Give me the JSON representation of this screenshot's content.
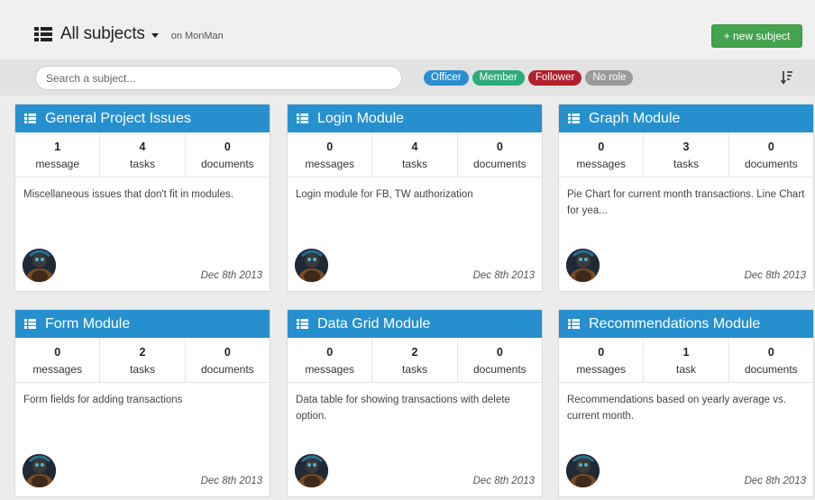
{
  "header": {
    "title": "All subjects",
    "context": "on MonMan",
    "new_button": "+ new subject"
  },
  "filter": {
    "search_placeholder": "Search a subject...",
    "roles": [
      {
        "label": "Officer",
        "color": "#2a8fd0"
      },
      {
        "label": "Member",
        "color": "#2dab7b"
      },
      {
        "label": "Follower",
        "color": "#b3202a"
      },
      {
        "label": "No role",
        "color": "#9a9a9a"
      }
    ]
  },
  "colors": {
    "accent": "#2690cf",
    "new_button": "#43a34e"
  },
  "icons": [
    "list-icon",
    "caret-down-icon",
    "sort-icon",
    "avatar"
  ],
  "subjects": [
    {
      "title": "General Project Issues",
      "stats": [
        {
          "num": "1",
          "label": "message"
        },
        {
          "num": "4",
          "label": "tasks"
        },
        {
          "num": "0",
          "label": "documents"
        }
      ],
      "description": "Miscellaneous issues that don't fit in modules.",
      "date": "Dec 8th 2013"
    },
    {
      "title": "Login Module",
      "stats": [
        {
          "num": "0",
          "label": "messages"
        },
        {
          "num": "4",
          "label": "tasks"
        },
        {
          "num": "0",
          "label": "documents"
        }
      ],
      "description": "Login module for FB, TW authorization",
      "date": "Dec 8th 2013"
    },
    {
      "title": "Graph Module",
      "stats": [
        {
          "num": "0",
          "label": "messages"
        },
        {
          "num": "3",
          "label": "tasks"
        },
        {
          "num": "0",
          "label": "documents"
        }
      ],
      "description": "Pie Chart for current month transactions. Line Chart for yea...",
      "date": "Dec 8th 2013"
    },
    {
      "title": "Form Module",
      "stats": [
        {
          "num": "0",
          "label": "messages"
        },
        {
          "num": "2",
          "label": "tasks"
        },
        {
          "num": "0",
          "label": "documents"
        }
      ],
      "description": "Form fields for adding transactions",
      "date": "Dec 8th 2013"
    },
    {
      "title": "Data Grid Module",
      "stats": [
        {
          "num": "0",
          "label": "messages"
        },
        {
          "num": "2",
          "label": "tasks"
        },
        {
          "num": "0",
          "label": "documents"
        }
      ],
      "description": "Data table for showing transactions with delete option.",
      "date": "Dec 8th 2013"
    },
    {
      "title": "Recommendations Module",
      "stats": [
        {
          "num": "0",
          "label": "messages"
        },
        {
          "num": "1",
          "label": "task"
        },
        {
          "num": "0",
          "label": "documents"
        }
      ],
      "description": "Recommendations based on yearly average vs. current month.",
      "date": "Dec 8th 2013"
    }
  ]
}
